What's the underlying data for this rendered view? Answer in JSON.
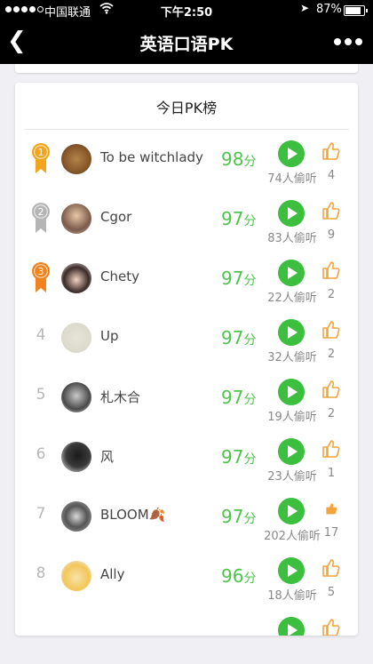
{
  "status": {
    "carrier": "中国联通",
    "time": "下午2:50",
    "battery": "87%"
  },
  "nav": {
    "title": "英语口语PK"
  },
  "card": {
    "title": "今日PK榜"
  },
  "colors": {
    "score": "#4cc54a",
    "play": "#3cbf3f",
    "like": "#f3a43b",
    "gold": "#f2a41c",
    "silver": "#b5b5b5",
    "bronze": "#f0831d"
  },
  "ranking": [
    {
      "rank": "1",
      "name": "To be witchlady",
      "score": "98",
      "unit": "分",
      "listeners": "74人偷听",
      "likes": "4",
      "liked": false
    },
    {
      "rank": "2",
      "name": "Cgor",
      "score": "97",
      "unit": "分",
      "listeners": "83人偷听",
      "likes": "9",
      "liked": false
    },
    {
      "rank": "3",
      "name": "Chety",
      "score": "97",
      "unit": "分",
      "listeners": "22人偷听",
      "likes": "2",
      "liked": false
    },
    {
      "rank": "4",
      "name": "Up",
      "score": "97",
      "unit": "分",
      "listeners": "32人偷听",
      "likes": "2",
      "liked": false
    },
    {
      "rank": "5",
      "name": "札木合",
      "score": "97",
      "unit": "分",
      "listeners": "19人偷听",
      "likes": "2",
      "liked": false
    },
    {
      "rank": "6",
      "name": "风",
      "score": "97",
      "unit": "分",
      "listeners": "23人偷听",
      "likes": "1",
      "liked": false
    },
    {
      "rank": "7",
      "name": "BLOOM🍂",
      "score": "97",
      "unit": "分",
      "listeners": "202人偷听",
      "likes": "17",
      "liked": true
    },
    {
      "rank": "8",
      "name": "Ally",
      "score": "96",
      "unit": "分",
      "listeners": "18人偷听",
      "likes": "5",
      "liked": false
    }
  ]
}
